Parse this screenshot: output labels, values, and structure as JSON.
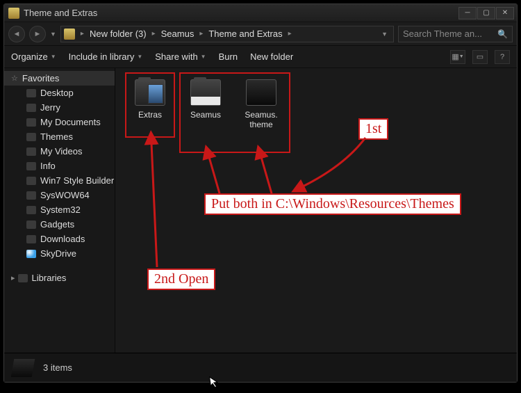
{
  "title": "Theme and Extras",
  "breadcrumb": [
    "New folder (3)",
    "Seamus",
    "Theme and Extras"
  ],
  "search": {
    "placeholder": "Search Theme an..."
  },
  "toolbar": {
    "organize": "Organize",
    "include": "Include in library",
    "share": "Share with",
    "burn": "Burn",
    "newfolder": "New folder"
  },
  "sidebar": {
    "favorites_label": "Favorites",
    "items": [
      "Desktop",
      "Jerry",
      "My Documents",
      "Themes",
      "My Videos",
      "Info",
      "Win7 Style Builder",
      "SysWOW64",
      "System32",
      "Gadgets",
      "Downloads",
      "SkyDrive"
    ],
    "libraries_label": "Libraries"
  },
  "files": {
    "extras": "Extras",
    "seamus": "Seamus",
    "theme_l1": "Seamus.",
    "theme_l2": "theme"
  },
  "annotations": {
    "first": "1st",
    "put": "Put both in C:\\Windows\\Resources\\Themes",
    "second": "2nd Open"
  },
  "status": {
    "count": "3 items"
  }
}
